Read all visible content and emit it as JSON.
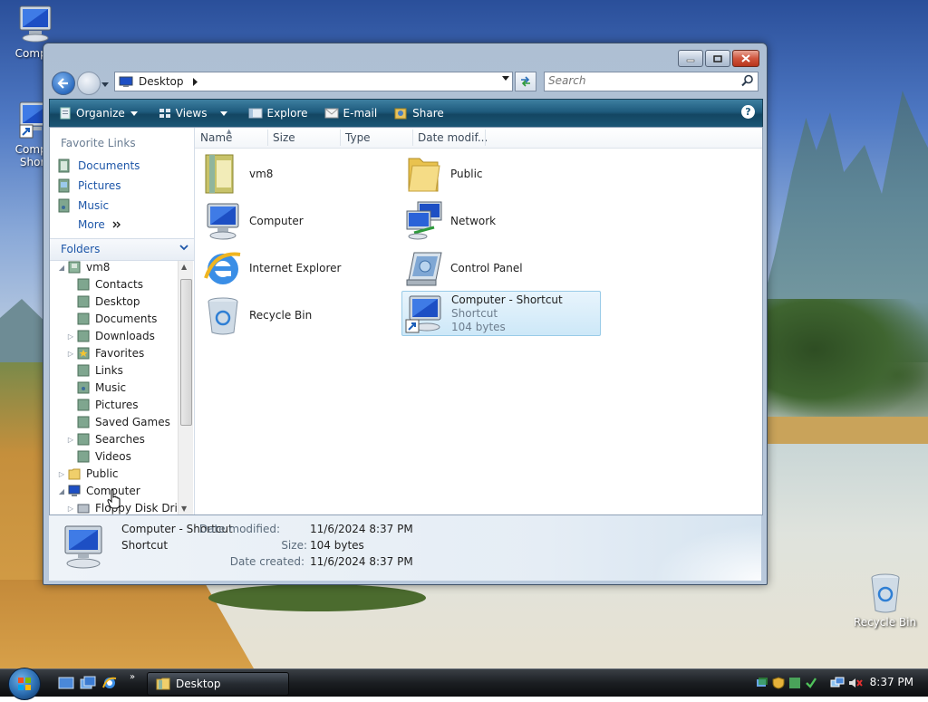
{
  "desktop": {
    "icons": [
      {
        "label_line1": "Compu",
        "label_line2": ""
      },
      {
        "label_line1": "Compu",
        "label_line2": "Short"
      },
      {
        "label_line1": "Recycle Bin",
        "label_line2": ""
      }
    ]
  },
  "window": {
    "address": "Desktop",
    "search_placeholder": "Search",
    "toolbar": {
      "organize": "Organize",
      "views": "Views",
      "explore": "Explore",
      "email": "E-mail",
      "share": "Share",
      "help": "?"
    },
    "navpane": {
      "favorite_links_title": "Favorite Links",
      "favorites": [
        "Documents",
        "Pictures",
        "Music"
      ],
      "more": "More",
      "folders_title": "Folders",
      "tree": [
        {
          "label": "vm8",
          "level": 1,
          "expander": "expanded"
        },
        {
          "label": "Contacts",
          "level": 2,
          "expander": "none"
        },
        {
          "label": "Desktop",
          "level": 2,
          "expander": "none"
        },
        {
          "label": "Documents",
          "level": 2,
          "expander": "none"
        },
        {
          "label": "Downloads",
          "level": 2,
          "expander": "collapsed"
        },
        {
          "label": "Favorites",
          "level": 2,
          "expander": "collapsed"
        },
        {
          "label": "Links",
          "level": 2,
          "expander": "none"
        },
        {
          "label": "Music",
          "level": 2,
          "expander": "none"
        },
        {
          "label": "Pictures",
          "level": 2,
          "expander": "none"
        },
        {
          "label": "Saved Games",
          "level": 2,
          "expander": "none"
        },
        {
          "label": "Searches",
          "level": 2,
          "expander": "collapsed"
        },
        {
          "label": "Videos",
          "level": 2,
          "expander": "none"
        },
        {
          "label": "Public",
          "level": 1,
          "expander": "collapsed"
        },
        {
          "label": "Computer",
          "level": 1,
          "expander": "expanded"
        },
        {
          "label": "Floppy Disk Drive",
          "level": 2,
          "expander": "collapsed"
        }
      ]
    },
    "columns": [
      "Name",
      "Size",
      "Type",
      "Date modif..."
    ],
    "files": [
      {
        "name": "vm8",
        "icon": "user-folder-icon"
      },
      {
        "name": "Public",
        "icon": "folder-icon"
      },
      {
        "name": "Computer",
        "icon": "computer-icon"
      },
      {
        "name": "Network",
        "icon": "network-icon"
      },
      {
        "name": "Internet Explorer",
        "icon": "internet-explorer-icon"
      },
      {
        "name": "Control Panel",
        "icon": "control-panel-icon"
      },
      {
        "name": "Recycle Bin",
        "icon": "recycle-bin-icon"
      },
      {
        "name": "Computer - Shortcut",
        "sub1": "Shortcut",
        "sub2": "104 bytes",
        "icon": "computer-shortcut-icon",
        "selected": true
      }
    ],
    "details": {
      "name": "Computer - Shortcut",
      "type": "Shortcut",
      "date_modified_label": "Date modified:",
      "date_modified": "11/6/2024 8:37 PM",
      "size_label": "Size:",
      "size": "104 bytes",
      "date_created_label": "Date created:",
      "date_created": "11/6/2024 8:37 PM"
    }
  },
  "taskbar": {
    "button_label": "Desktop",
    "clock": "8:37 PM"
  },
  "colors": {
    "link_blue": "#1d56a8",
    "toolbar_teal": "#1e5a7c",
    "selection": "#cde8f8"
  }
}
